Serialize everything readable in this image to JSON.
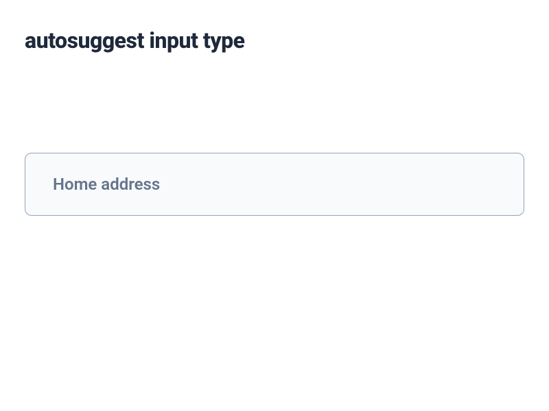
{
  "title": "autosuggest input type",
  "input": {
    "placeholder": "Home address",
    "value": ""
  }
}
